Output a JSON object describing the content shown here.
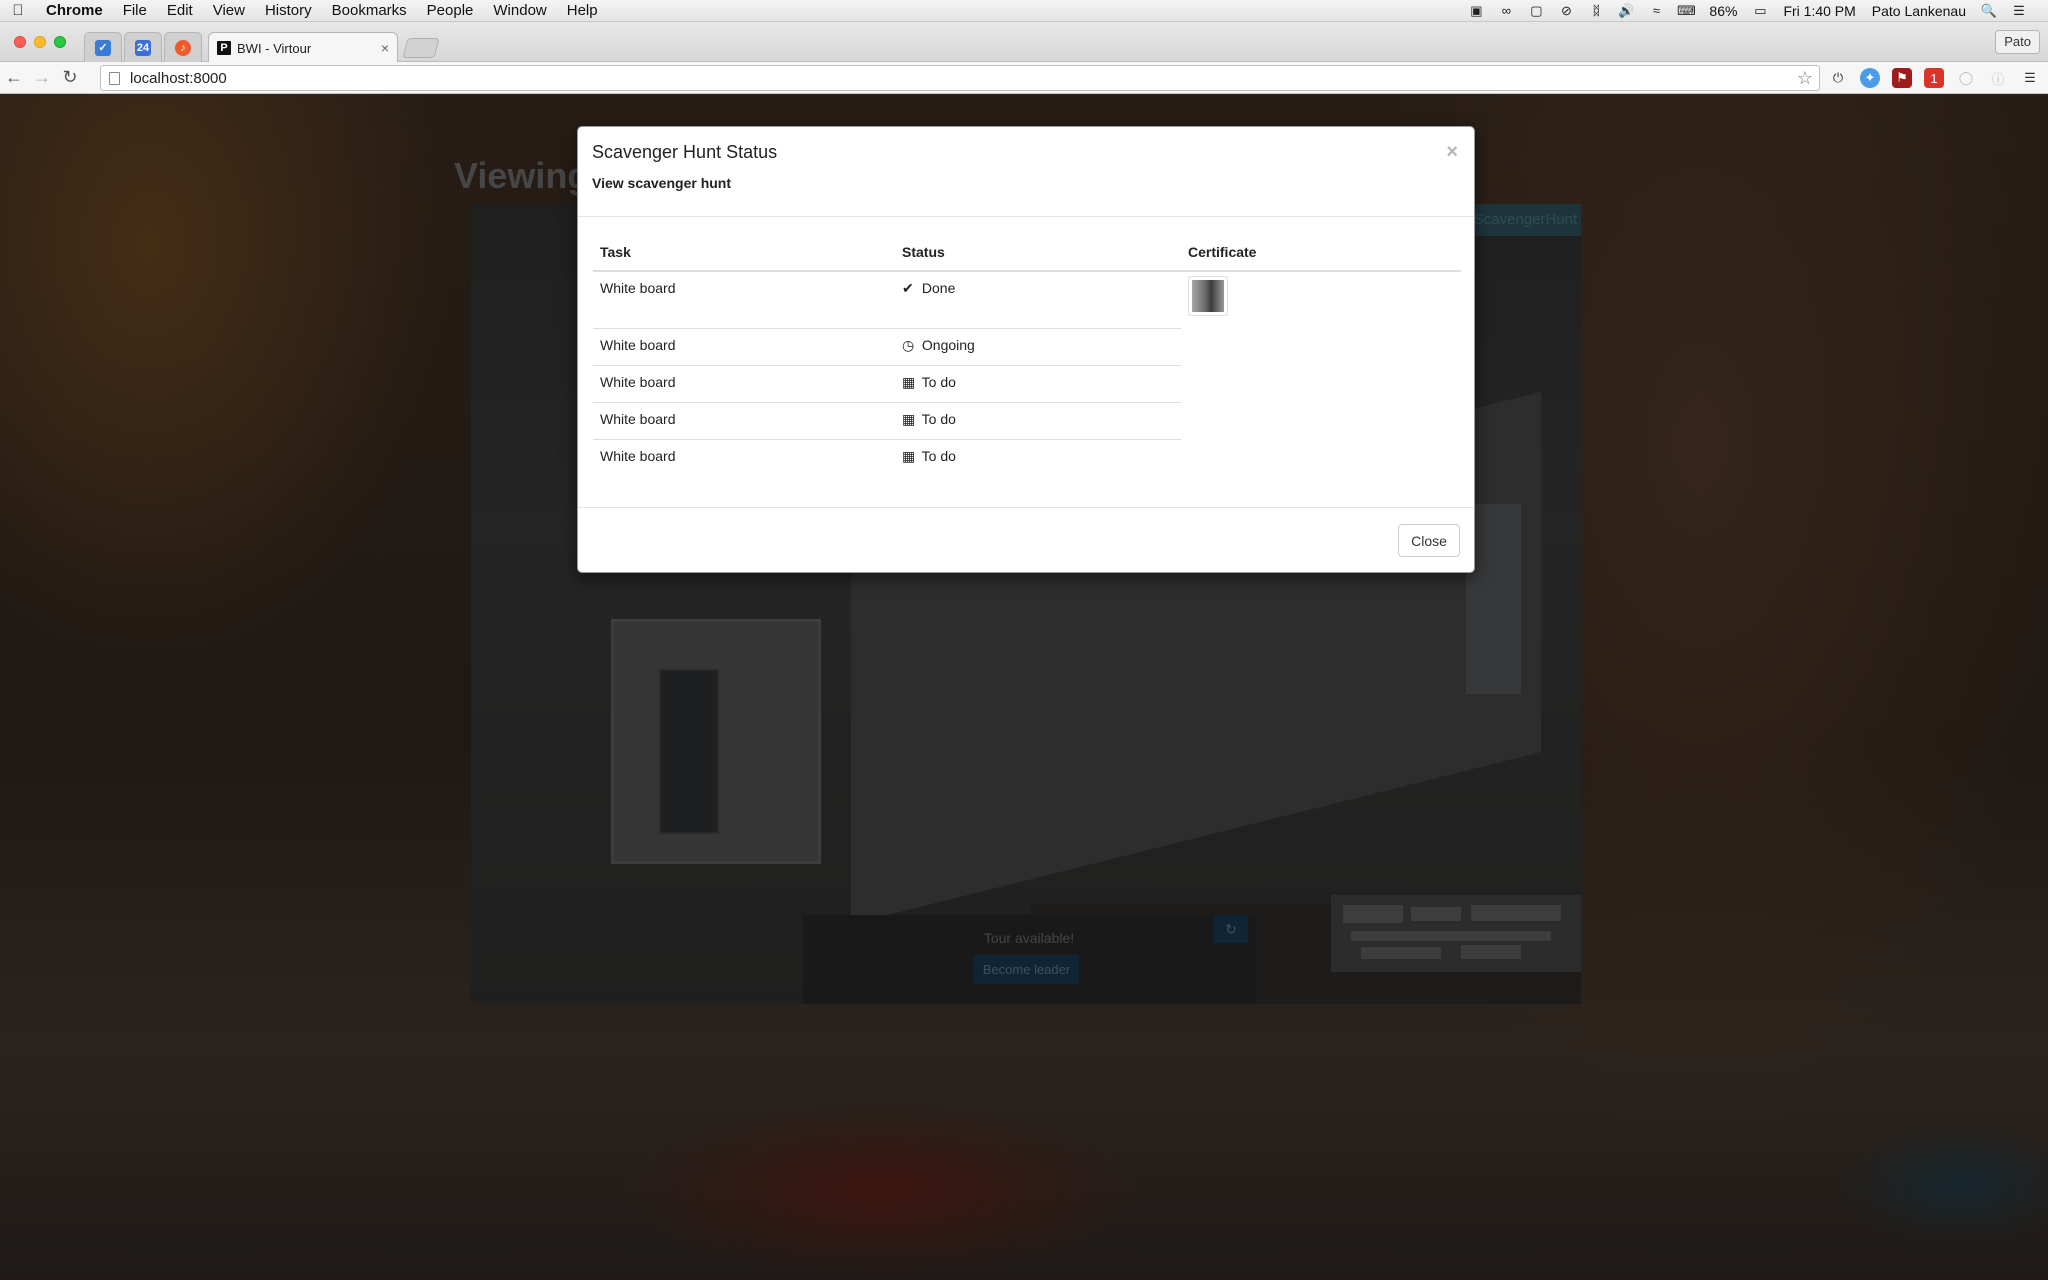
{
  "menubar": {
    "items": [
      "Chrome",
      "File",
      "Edit",
      "View",
      "History",
      "Bookmarks",
      "People",
      "Window",
      "Help"
    ],
    "battery": "86%",
    "time": "Fri 1:40 PM",
    "user": "Pato Lankenau"
  },
  "tabs": {
    "active_title": "BWI - Virtour",
    "pinned_badge_calendar": "24",
    "profile_button": "Pato"
  },
  "toolbar": {
    "url": "localhost:8000",
    "extension_badge": "1"
  },
  "page": {
    "heading_partial": "Viewing",
    "tag_label": "ScavengerHunt",
    "tour_status": "Tour available!",
    "become_leader_label": "Become leader"
  },
  "modal": {
    "title": "Scavenger Hunt Status",
    "subtitle": "View scavenger hunt",
    "close_x": "×",
    "columns": [
      "Task",
      "Status",
      "Certificate"
    ],
    "rows": [
      {
        "task": "White board",
        "status": "Done",
        "icon": "check-icon"
      },
      {
        "task": "White board",
        "status": "Ongoing",
        "icon": "clock-icon"
      },
      {
        "task": "White board",
        "status": "To do",
        "icon": "calendar-icon"
      },
      {
        "task": "White board",
        "status": "To do",
        "icon": "calendar-icon"
      },
      {
        "task": "White board",
        "status": "To do",
        "icon": "calendar-icon"
      }
    ],
    "close_button": "Close"
  },
  "colors": {
    "viewer_accent": "#3b6876",
    "leader_button": "#1e4b6b"
  }
}
